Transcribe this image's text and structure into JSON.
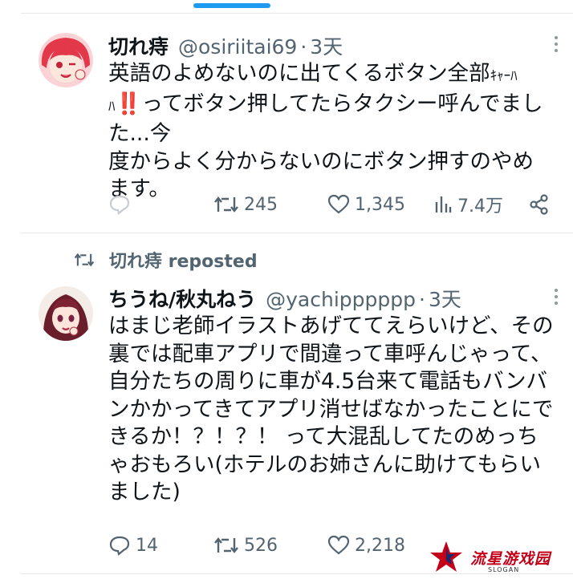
{
  "tweets": [
    {
      "name": "切れ痔",
      "handle": "@osiriitai69",
      "dot": "·",
      "time": "3天",
      "text_lines": [
        "英語のよめないのに出てくるボタン全部",
        "ってボタン押してたらタクシー呼んでました...今",
        "度からよく分からないのにボタン押すのやめ",
        "ます。"
      ],
      "text_small": "ｷｬｰﾊ",
      "text_small2": "ﾊ",
      "text_bang": "‼️",
      "reply_count": "",
      "repost_count": "245",
      "like_count": "1,345",
      "view_count": "7.4万"
    },
    {
      "repost_label": "切れ痔 reposted",
      "name": "ちうね/秋丸ねう",
      "handle": "@yachipppppp",
      "dot": "·",
      "time": "3天",
      "text": "はまじ老師イラストあげててえらいけど、その裏では配車アプリで間違って車呼んじゃって、自分たちの周りに車が4.5台来て電話もバンバンかかってきてアプリ消せばなかったことにできるか！？！？！ って大混乱してたのめっちゃおもろい(ホテルのお姉さんに助けてもらいました)",
      "reply_count": "14",
      "repost_count": "526",
      "like_count": "2,218"
    }
  ],
  "watermark": {
    "text": "流星游戏园",
    "sub": "SLOGAN"
  },
  "colors": {
    "accent": "#1d9bf0",
    "secondary_text": "#536471",
    "watermark_red": "#c40018"
  },
  "icons": [
    "reply-icon",
    "repost-icon",
    "like-icon",
    "views-icon",
    "share-icon",
    "more-icon"
  ]
}
